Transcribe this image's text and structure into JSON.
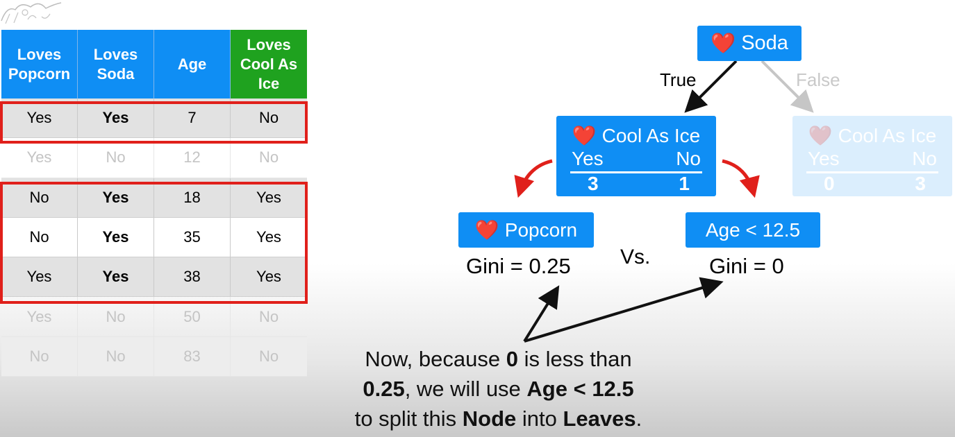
{
  "table": {
    "headers": [
      "Loves Popcorn",
      "Loves Soda",
      "Age",
      "Loves Cool As Ice"
    ],
    "rows": [
      {
        "cells": [
          "Yes",
          "Yes",
          "7",
          "No"
        ],
        "state": "selected"
      },
      {
        "cells": [
          "Yes",
          "No",
          "12",
          "No"
        ],
        "state": "dimmed"
      },
      {
        "cells": [
          "No",
          "Yes",
          "18",
          "Yes"
        ],
        "state": "selected"
      },
      {
        "cells": [
          "No",
          "Yes",
          "35",
          "Yes"
        ],
        "state": "selected"
      },
      {
        "cells": [
          "Yes",
          "Yes",
          "38",
          "Yes"
        ],
        "state": "selected"
      },
      {
        "cells": [
          "Yes",
          "No",
          "50",
          "No"
        ],
        "state": "dimmed"
      },
      {
        "cells": [
          "No",
          "No",
          "83",
          "No"
        ],
        "state": "dimmed"
      }
    ]
  },
  "tree": {
    "root": {
      "label": "Soda"
    },
    "true_label": "True",
    "false_label": "False",
    "left_child": {
      "label": "Cool As Ice",
      "yes": "Yes",
      "no": "No",
      "yes_count": "3",
      "no_count": "1"
    },
    "right_child": {
      "label": "Cool As Ice",
      "yes": "Yes",
      "no": "No",
      "yes_count": "0",
      "no_count": "3"
    },
    "candidate_popcorn": {
      "label": "Popcorn",
      "gini": "Gini = 0.25"
    },
    "candidate_age": {
      "label": "Age < 12.5",
      "gini": "Gini = 0"
    },
    "vs": "Vs."
  },
  "caption": {
    "l1a": "Now, because ",
    "l1b": "0",
    "l1c": " is less than",
    "l2a": "0.25",
    "l2b": ", we will use ",
    "l2c": "Age < 12.5",
    "l3a": "to split this ",
    "l3b": "Node",
    "l3c": " into ",
    "l3d": "Leaves",
    "l3e": "."
  },
  "colors": {
    "blue": "#0f8ef4",
    "green": "#1fa21f",
    "red": "#e0201b",
    "heart": "#e0201b"
  }
}
